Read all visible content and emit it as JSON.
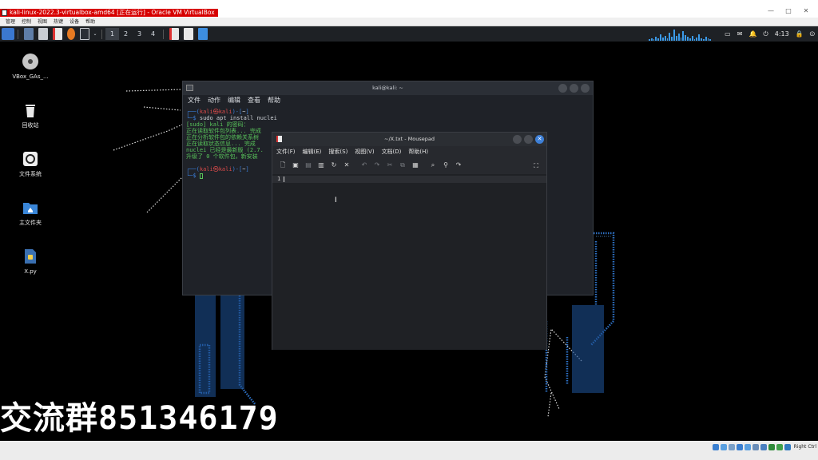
{
  "vbox": {
    "title": "kali-linux-2022.3-virtualbox-amd64 [正在运行] - Oracle VM VirtualBox",
    "menu": [
      "管理",
      "控制",
      "视图",
      "热键",
      "设备",
      "帮助"
    ],
    "window_controls": {
      "minimize": "—",
      "maximize": "□",
      "close": "✕"
    },
    "status": {
      "host_key": "Right Ctrl"
    }
  },
  "panel": {
    "workspaces": [
      "1",
      "2",
      "3",
      "4"
    ],
    "clock": "4:13",
    "icons": [
      "kali-menu-icon",
      "terminal-icon",
      "file-manager-icon",
      "text-editor-icon",
      "firefox-icon",
      "terminal-emulator-icon",
      "mousepad-task-icon",
      "screenshot-task-icon"
    ],
    "accent": "#3b78d0"
  },
  "desktop": {
    "icons": [
      {
        "label": "VBox_GAs_...",
        "icon": "disc-icon"
      },
      {
        "label": "回收站",
        "icon": "trash-icon"
      },
      {
        "label": "文件系统",
        "icon": "filesystem-icon"
      },
      {
        "label": "主文件夹",
        "icon": "home-folder-icon"
      },
      {
        "label": "X.py",
        "icon": "python-file-icon"
      }
    ],
    "watermark": "交流群851346179"
  },
  "terminal": {
    "title": "kali@kali: ~",
    "menu": [
      "文件",
      "动作",
      "编辑",
      "查看",
      "帮助"
    ],
    "prompt_user": "kali",
    "prompt_host": "kali",
    "prompt_dir": "~",
    "command": "sudo apt install nuclei",
    "lines": [
      "[sudo] kali 的密码：",
      "正在读取软件包列表... 完成",
      "正在分析软件包的依赖关系树",
      "正在读取状态信息... 完成",
      "nuclei 已经是最新版 (2.7.",
      "升级了 0 个软件包，新安装"
    ]
  },
  "mousepad": {
    "title": "~/X.txt - Mousepad",
    "menu": [
      "文件(F)",
      "编辑(E)",
      "搜索(S)",
      "视图(V)",
      "文档(D)",
      "帮助(H)"
    ],
    "line_number": "1",
    "toolbar": [
      "new-document-icon",
      "new-window-icon",
      "save-icon",
      "save-as-icon",
      "reload-icon",
      "close-doc-icon",
      "undo-icon",
      "redo-icon",
      "cut-icon",
      "copy-icon",
      "paste-icon",
      "find-icon",
      "find-replace-icon",
      "goto-icon",
      "fullscreen-icon"
    ]
  }
}
